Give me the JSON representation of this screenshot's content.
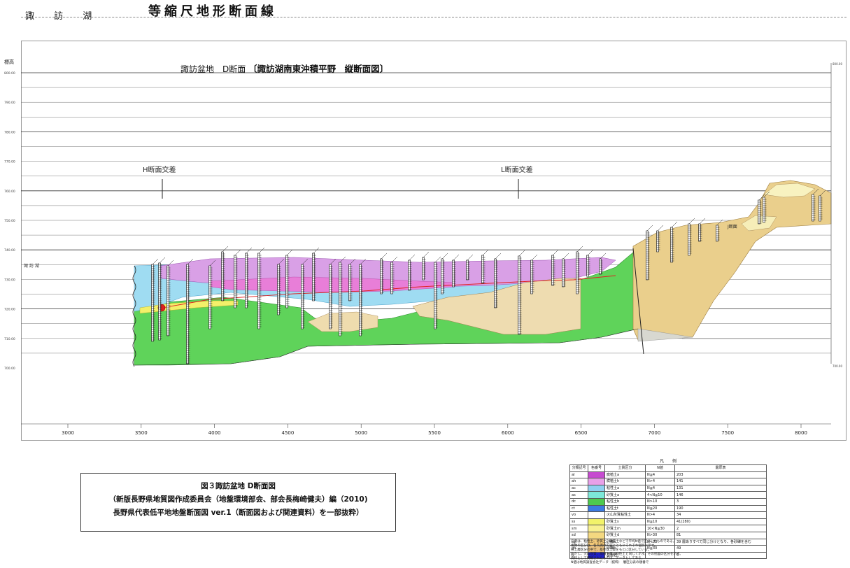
{
  "header": {
    "left_label": "諏 訪 湖",
    "title": "等縮尺地形断面線"
  },
  "section": {
    "title_prefix": "諏訪盆地　D断面",
    "title_main": "〔諏訪湖南東沖積平野　縦断面図〕",
    "y_axis_label": "標高",
    "lake_level_label": "諏 訪 湖",
    "cross_markers": [
      "H断面交差",
      "L断面交差",
      "J断面"
    ],
    "elevation_ticks": [
      "800.00",
      "790.00",
      "780.00",
      "770.00",
      "760.00",
      "750.00",
      "740.00",
      "730.00",
      "720.00",
      "710.00",
      "700.00"
    ],
    "distance_ticks": [
      "3000",
      "3500",
      "4000",
      "4500",
      "5000",
      "5500",
      "6000",
      "6500",
      "7000",
      "7500",
      "8000"
    ],
    "right_scale_top": "800.00",
    "right_scale_bottom": "700.00"
  },
  "caption": {
    "line1": "図３諏訪盆地 D断面図",
    "line2": "（新版長野県地質図作成委員会（地盤環境部会、部会長梅崎健夫）編（2010)",
    "line3": "長野県代表低平地地盤断面図 ver.1（断面図および関連資料）を一部抜粋）"
  },
  "legend": {
    "title": "凡　　例",
    "headers": [
      "分類記号",
      "色番号",
      "土質区分",
      "N値",
      "層厚表"
    ],
    "rows": [
      {
        "code": "al",
        "color": "#c64bd0",
        "desc": "腐植土a",
        "n": "N≦4",
        "note": "203"
      },
      {
        "code": "ah",
        "color": "#e8a0e8",
        "desc": "腐植土h",
        "n": "N>4",
        "note": "141"
      },
      {
        "code": "ac",
        "color": "#8fd0f0",
        "desc": "粘性土a",
        "n": "N≦4",
        "note": "131"
      },
      {
        "code": "as",
        "color": "#7ce8d8",
        "desc": "砂質土a",
        "n": "4<N≦10",
        "note": "146"
      },
      {
        "code": "dc",
        "color": "#4ec94e",
        "desc": "粘性土b",
        "n": "N>10",
        "note": "3"
      },
      {
        "code": "ct",
        "color": "#3c7ae0",
        "desc": "粘性土t",
        "n": "N≦20",
        "note": "190"
      },
      {
        "code": "vo",
        "color": "#ffffff",
        "desc": "火山灰質粘性土",
        "n": "N>4",
        "note": "34"
      },
      {
        "code": "ss",
        "color": "#f2f26a",
        "desc": "砂質土s",
        "n": "N≦10",
        "note": "41(280)"
      },
      {
        "code": "sm",
        "color": "#f8f090",
        "desc": "砂質土m",
        "n": "10<N≦30",
        "note": "2"
      },
      {
        "code": "sd",
        "color": "#f4d880",
        "desc": "砂質土d",
        "n": "N>30",
        "note": "81"
      },
      {
        "code": "sg",
        "color": "#f2c878",
        "desc": "砂礫a",
        "n": "N<30",
        "note": "39 層ありすべて同じ分けとなり、各砂礫を含む"
      },
      {
        "code": "gh",
        "color": "#e8c080",
        "desc": "砂礫h",
        "n": "N≧30",
        "note": "49"
      },
      {
        "code": "R",
        "color": "#2020c8",
        "desc": "基盤岩",
        "n": "",
        "note": "5"
      }
    ],
    "notes": [
      "凡例は、粘性土、砂質土、礫質土などで平均N値で区分したものである。",
      "複数の区分は、各凡例の内容とともにそれぞれ個別に示す。",
      "各土層区分の中で、基準は土質をもとに区分している。",
      "ただし、火山灰質、腐植土層は粘性土と同じく示す。その他図の区分を示す。",
      "資料として掲載されたものは、データとしてある。",
      "N値は地質調査会社データ（抜粋）　層区分表の順番で"
    ]
  }
}
